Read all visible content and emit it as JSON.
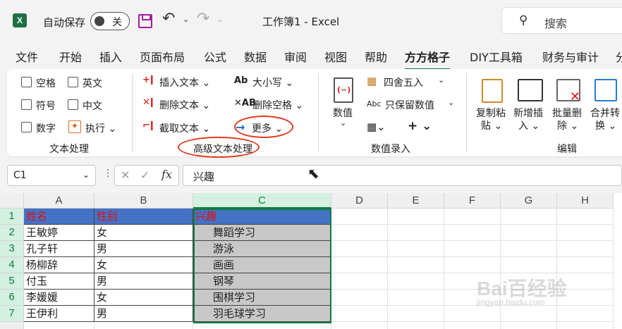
{
  "title_bar": {
    "app_logo": "X",
    "autosave_label": "自动保存",
    "autosave_state": "关",
    "doc_title": "工作簿1 - Excel",
    "search_placeholder": "搜索",
    "icons": [
      "excel-logo-icon",
      "save-icon",
      "undo-icon",
      "redo-icon",
      "search-icon"
    ]
  },
  "tabs": [
    {
      "label": "文件"
    },
    {
      "label": "开始"
    },
    {
      "label": "插入"
    },
    {
      "label": "页面布局"
    },
    {
      "label": "公式"
    },
    {
      "label": "数据"
    },
    {
      "label": "审阅"
    },
    {
      "label": "视图"
    },
    {
      "label": "帮助"
    },
    {
      "label": "方方格子",
      "active": true
    },
    {
      "label": "DIY工具箱"
    },
    {
      "label": "财务与审计"
    },
    {
      "label": "分"
    }
  ],
  "ribbon": {
    "group_text": {
      "label": "文本处理",
      "checkboxes": [
        "空格",
        "英文",
        "符号",
        "中文",
        "数字"
      ],
      "execute": "执行"
    },
    "group_advanced": {
      "label": "高级文本处理",
      "insert_text": "插入文本",
      "delete_text": "删除文本",
      "extract_text": "截取文本",
      "case": "大小写",
      "delete_spaces": "删除空格",
      "more": "更多",
      "case_icon": "Ab",
      "spaces_icon": "AB"
    },
    "group_numeric": {
      "label": "数值录入",
      "value_btn": "数值",
      "round": "四舍五入",
      "keep_values": "只保留数值",
      "keep_icon": "Abc",
      "plus": "+"
    },
    "group_edit": {
      "label": "编辑",
      "copy_paste": [
        "复制粘",
        "贴"
      ],
      "insert_new": [
        "新增插",
        "入"
      ],
      "batch_delete": [
        "批量删",
        "除"
      ],
      "merge_convert": [
        "合并转",
        "换"
      ]
    }
  },
  "formula_bar": {
    "name_box": "C1",
    "fx": "fx",
    "value": "兴趣"
  },
  "sheet": {
    "columns": [
      "A",
      "B",
      "C",
      "D",
      "E",
      "F",
      "G",
      "H"
    ],
    "rows": [
      "1",
      "2",
      "3",
      "4",
      "5",
      "6",
      "7"
    ],
    "cells": [
      [
        "姓名",
        "性别",
        "兴趣"
      ],
      [
        "王敏婷",
        "女",
        "舞蹈学习"
      ],
      [
        "孔子轩",
        "男",
        "游泳"
      ],
      [
        "杨柳辞",
        "女",
        "画画"
      ],
      [
        "付玉",
        "男",
        "钢琴"
      ],
      [
        "李媛媛",
        "女",
        "围棋学习"
      ],
      [
        "王伊利",
        "男",
        "羽毛球学习"
      ]
    ]
  },
  "watermark": {
    "main": "Bai百经验",
    "sub": "jingyan.baidu.com"
  },
  "colors": {
    "excel_green": "#107c41",
    "header_fill": "#4472c4",
    "header_text": "#e01010",
    "selection_fill": "#c8c8c8",
    "annotation_red": "#e03a1e"
  }
}
